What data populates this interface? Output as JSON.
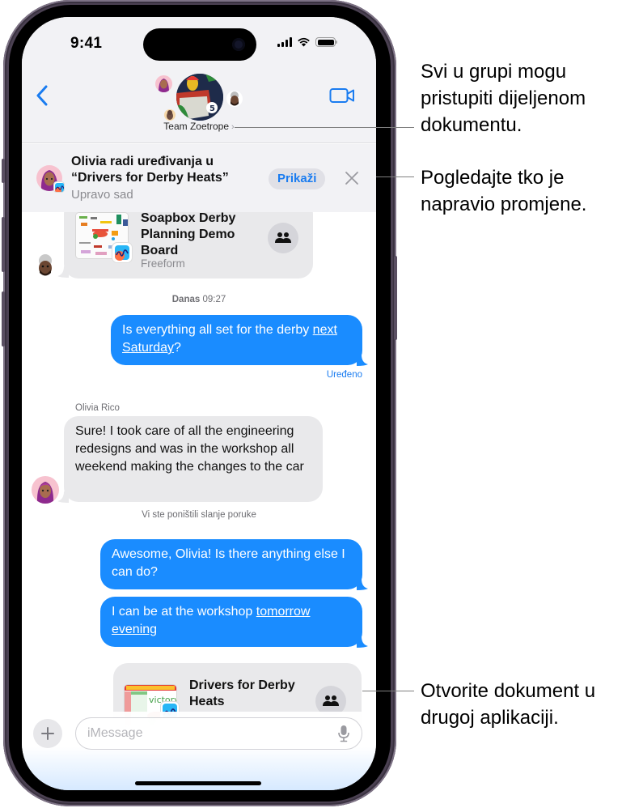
{
  "status_bar": {
    "time": "9:41",
    "icons": [
      "cellular-signal-icon",
      "wifi-icon",
      "battery-icon"
    ]
  },
  "header": {
    "back_icon": "chevron-left-icon",
    "group_name": "Team Zoetrope",
    "group_name_chevron": "›",
    "video_icon": "video-camera-icon"
  },
  "banner": {
    "title": "Olivia radi uređivanja u “Drivers for Derby Heats”",
    "subtitle": "Upravo sad",
    "view_button": "Prikaži",
    "close_icon": "close-icon"
  },
  "conversation": {
    "shared_card_top": {
      "title": "Soapbox Derby Planning Demo Board",
      "app": "Freeform",
      "collab_icon": "people-icon"
    },
    "timestamp": {
      "day": "Danas",
      "time": "09:27"
    },
    "outgoing_1": {
      "text_before_link": "Is everything all set for the derby ",
      "link": "next Saturday",
      "text_after_link": "?",
      "status": "Uređeno"
    },
    "incoming_1": {
      "sender": "Olivia Rico",
      "text": "Sure! I took care of all the engineering redesigns and was in the workshop all weekend making the changes to the car"
    },
    "unsend_notice": "Vi ste poništili slanje poruke",
    "outgoing_2": {
      "text": "Awesome, Olivia! Is there anything else I can do?"
    },
    "outgoing_3": {
      "text_before_link": "I can be at the workshop ",
      "link": "tomorrow evening"
    },
    "shared_card_bottom": {
      "title": "Drivers for Derby Heats",
      "collab_icon": "people-icon"
    }
  },
  "input_bar": {
    "plus_icon": "plus-icon",
    "placeholder": "iMessage",
    "value": "",
    "mic_icon": "microphone-icon"
  },
  "callouts": [
    {
      "text": "Svi u grupi mogu pristupiti dijeljenom dokumentu."
    },
    {
      "text": "Pogledajte tko je napravio promjene."
    },
    {
      "text": "Otvorite dokument u drugoj aplikaciji."
    }
  ],
  "colors": {
    "accent_blue": "#1a7cf0",
    "outgoing_bubble": "#1a8cff",
    "incoming_bubble": "#e9e9eb",
    "header_bg": "#f2f2f5"
  }
}
